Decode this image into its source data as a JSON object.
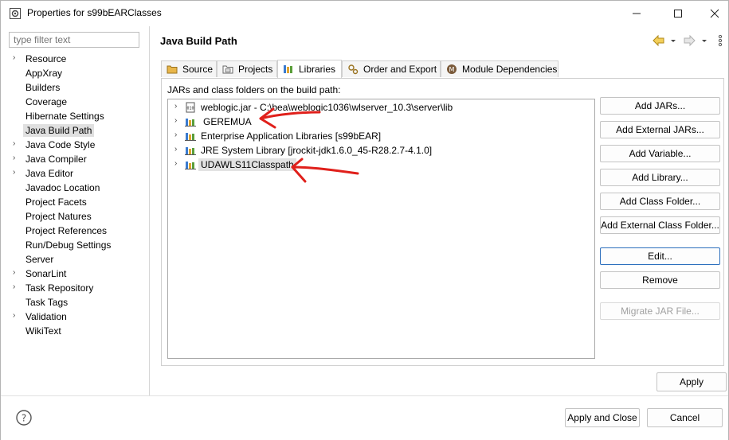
{
  "window": {
    "title": "Properties for s99bEARClasses",
    "controls": [
      "minimize",
      "maximize",
      "close"
    ]
  },
  "filter": {
    "placeholder": "type filter text"
  },
  "nav_tree": [
    {
      "label": "Resource",
      "expandable": true
    },
    {
      "label": "AppXray",
      "expandable": false
    },
    {
      "label": "Builders",
      "expandable": false
    },
    {
      "label": "Coverage",
      "expandable": false
    },
    {
      "label": "Hibernate Settings",
      "expandable": false
    },
    {
      "label": "Java Build Path",
      "expandable": false,
      "selected": true
    },
    {
      "label": "Java Code Style",
      "expandable": true
    },
    {
      "label": "Java Compiler",
      "expandable": true
    },
    {
      "label": "Java Editor",
      "expandable": true
    },
    {
      "label": "Javadoc Location",
      "expandable": false
    },
    {
      "label": "Project Facets",
      "expandable": false
    },
    {
      "label": "Project Natures",
      "expandable": false
    },
    {
      "label": "Project References",
      "expandable": false
    },
    {
      "label": "Run/Debug Settings",
      "expandable": false
    },
    {
      "label": "Server",
      "expandable": false
    },
    {
      "label": "SonarLint",
      "expandable": true
    },
    {
      "label": "Task Repository",
      "expandable": true
    },
    {
      "label": "Task Tags",
      "expandable": false
    },
    {
      "label": "Validation",
      "expandable": true
    },
    {
      "label": "WikiText",
      "expandable": false
    }
  ],
  "page": {
    "heading": "Java Build Path",
    "nav_icons": [
      "back-arrow-icon",
      "dropdown-icon",
      "forward-arrow-icon",
      "dropdown-icon",
      "more-icon"
    ]
  },
  "tabs": [
    {
      "label": "Source",
      "icon": "source-folder-icon"
    },
    {
      "label": "Projects",
      "icon": "projects-folder-icon"
    },
    {
      "label": "Libraries",
      "icon": "libraries-icon",
      "active": true
    },
    {
      "label": "Order and Export",
      "icon": "order-export-icon"
    },
    {
      "label": "Module Dependencies",
      "icon": "module-icon"
    }
  ],
  "libraries": {
    "caption": "JARs and class folders on the build path:",
    "items": [
      {
        "label": "weblogic.jar - C:\\bea\\weblogic1036\\wlserver_10.3\\server\\lib",
        "icon": "jar-file-icon"
      },
      {
        "label": "GEREMUA",
        "icon": "library-icon"
      },
      {
        "label": "Enterprise Application Libraries [s99bEAR]",
        "icon": "library-icon"
      },
      {
        "label": "JRE System Library [jrockit-jdk1.6.0_45-R28.2.7-4.1.0]",
        "icon": "library-icon"
      },
      {
        "label": "UDAWLS11Classpath",
        "icon": "library-icon",
        "selected": true
      }
    ]
  },
  "side_buttons": {
    "add_jars": "Add JARs...",
    "add_external_jars": "Add External JARs...",
    "add_variable": "Add Variable...",
    "add_library": "Add Library...",
    "add_class_folder": "Add Class Folder...",
    "add_external_class_folder": "Add External Class Folder...",
    "edit": "Edit...",
    "remove": "Remove",
    "migrate_jar": "Migrate JAR File..."
  },
  "apply_button": "Apply",
  "footer": {
    "apply_and_close": "Apply and Close",
    "cancel": "Cancel"
  },
  "colors": {
    "selection": "#e0e0e0",
    "focus_border": "#2c6fbd",
    "annotation_arrow": "#e0201b"
  }
}
